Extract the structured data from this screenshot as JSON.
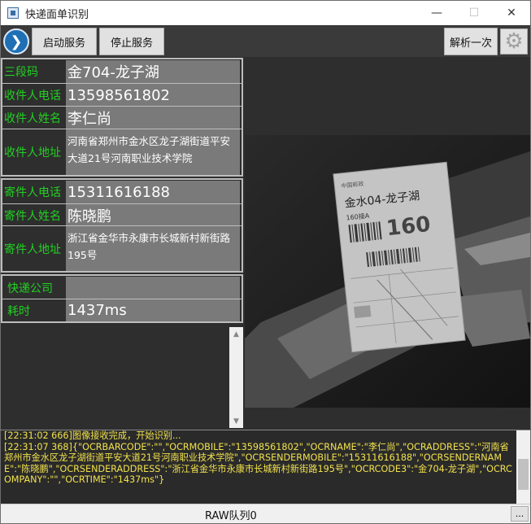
{
  "window": {
    "title": "快递面单识别",
    "minimize": "—",
    "maximize": "☐",
    "close": "✕"
  },
  "toolbar": {
    "start_label": "启动服务",
    "stop_label": "停止服务",
    "parse_label": "解析一次",
    "arrow_glyph": "❯",
    "gear_glyph": "⚙"
  },
  "recipient": {
    "code3_label": "三段码",
    "code3_value": "金704-龙子湖",
    "phone_label": "收件人电话",
    "phone_value": "13598561802",
    "name_label": "收件人姓名",
    "name_value": "李仁尚",
    "addr_label": "收件人地址",
    "addr_value": "河南省郑州市金水区龙子湖街道平安大道21号河南职业技术学院"
  },
  "sender": {
    "phone_label": "寄件人电话",
    "phone_value": "15311616188",
    "name_label": "寄件人姓名",
    "name_value": "陈晓鹏",
    "addr_label": "寄件人地址",
    "addr_value": "浙江省金华市永康市长城新村新街路195号"
  },
  "meta": {
    "company_label": "快递公司",
    "company_value": "",
    "time_label": "耗时",
    "time_value": "1437ms"
  },
  "photo": {
    "headline": "金水04-龙子湖",
    "sort_code": "160",
    "sort_sub": "160接A"
  },
  "log": {
    "text": "[22:31:02 666]图像接收完成，开始识别...\n[22:31:07 368]{\"OCRBARCODE\":\"\",\"OCRMOBILE\":\"13598561802\",\"OCRNAME\":\"李仁尚\",\"OCRADDRESS\":\"河南省郑州市金水区龙子湖街道平安大道21号河南职业技术学院\",\"OCRSENDERMOBILE\":\"15311616188\",\"OCRSENDERNAME\":\"陈晓鹏\",\"OCRSENDERADDRESS\":\"浙江省金华市永康市长城新村新街路195号\",\"OCRCODE3\":\"金704-龙子湖\",\"OCRCOMPANY\":\"\",\"OCRTIME\":\"1437ms\"}"
  },
  "status": {
    "queue_text": "RAW队列0",
    "more_label": "..."
  }
}
